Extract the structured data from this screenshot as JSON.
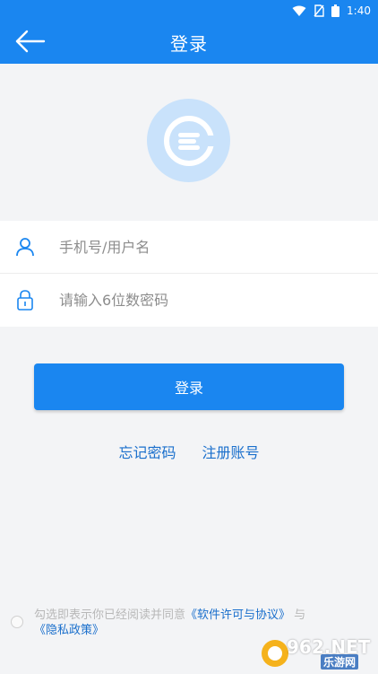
{
  "status_bar": {
    "time": "1:40"
  },
  "header": {
    "title": "登录"
  },
  "form": {
    "username_placeholder": "手机号/用户名",
    "password_placeholder": "请输入6位数密码"
  },
  "actions": {
    "login_label": "登录",
    "forgot_password": "忘记密码",
    "register": "注册账号"
  },
  "agreement": {
    "prefix": "勾选即表示你已经阅读并同意",
    "license_link": "《软件许可与协议》",
    "conjunction": "与",
    "privacy_link": "《隐私政策》"
  },
  "watermark": {
    "brand": "962.NET",
    "sub": "乐游网"
  },
  "colors": {
    "primary": "#1a86f0",
    "link": "#1a6fcc",
    "background": "#f3f4f6",
    "logo_bg": "#c9e2fb"
  },
  "icons": [
    "arrow-left-icon",
    "wifi-icon",
    "no-sim-icon",
    "battery-icon",
    "user-icon",
    "lock-icon",
    "app-logo"
  ]
}
